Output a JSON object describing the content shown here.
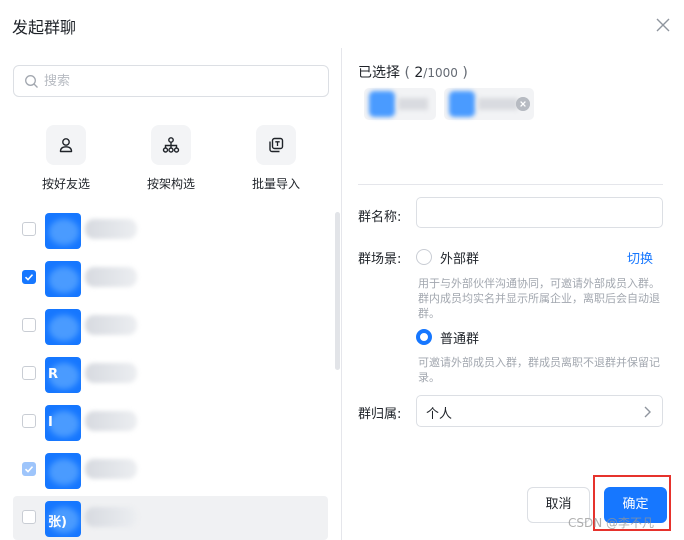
{
  "dialog": {
    "title": "发起群聊"
  },
  "search": {
    "placeholder": "搜索"
  },
  "sources": [
    {
      "label": "按好友选",
      "icon": "person-icon"
    },
    {
      "label": "按架构选",
      "icon": "org-structure-icon"
    },
    {
      "label": "批量导入",
      "icon": "import-icon"
    }
  ],
  "list": [
    {
      "checked": false,
      "disabled": false,
      "avatar_text": ""
    },
    {
      "checked": true,
      "disabled": false,
      "avatar_text": ""
    },
    {
      "checked": false,
      "disabled": false,
      "avatar_text": ""
    },
    {
      "checked": false,
      "disabled": false,
      "avatar_text": "R"
    },
    {
      "checked": false,
      "disabled": false,
      "avatar_text": "I"
    },
    {
      "checked": true,
      "disabled": true,
      "avatar_text": ""
    },
    {
      "checked": false,
      "disabled": false,
      "avatar_text": "张)"
    }
  ],
  "selected": {
    "label": "已选择",
    "count": "2",
    "max": "/1000"
  },
  "form": {
    "name_label": "群名称:",
    "scene_label": "群场景:",
    "external_label": "外部群",
    "switch_label": "切换",
    "external_desc": "用于与外部伙伴沟通协同，可邀请外部成员入群。群内成员均实名并显示所属企业，离职后会自动退群。",
    "normal_label": "普通群",
    "normal_desc": "可邀请外部成员入群，群成员离职不退群并保留记录。",
    "owner_label": "群归属:",
    "owner_value": "个人",
    "selected_scene": "normal"
  },
  "buttons": {
    "cancel": "取消",
    "ok": "确定"
  },
  "watermark": "CSDN @李不凡",
  "colors": {
    "accent": "#1677ff",
    "highlight_box": "#e6322c"
  }
}
